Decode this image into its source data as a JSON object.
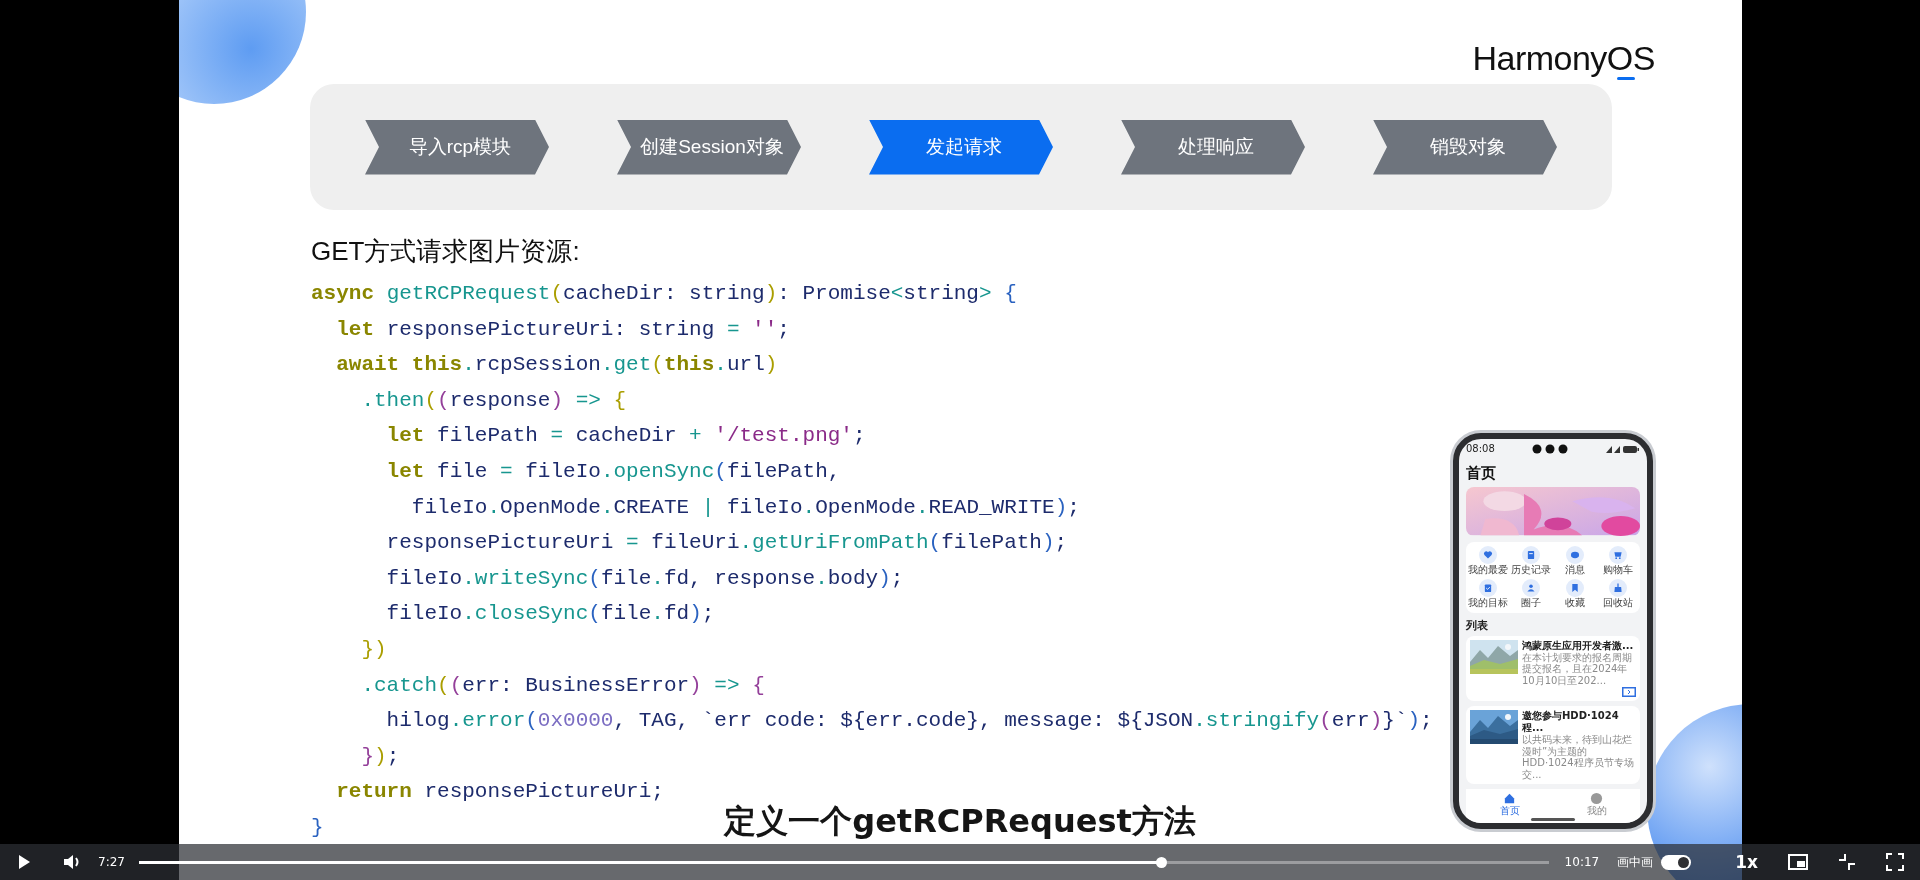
{
  "slide": {
    "logo": "HarmonyOS",
    "steps": [
      {
        "label": "导入rcp模块",
        "selected": false
      },
      {
        "label": "创建Session对象",
        "selected": false
      },
      {
        "label": "发起请求",
        "selected": true
      },
      {
        "label": "处理响应",
        "selected": false
      },
      {
        "label": "销毁对象",
        "selected": false
      }
    ],
    "heading": "GET方式请求图片资源:",
    "code_lines": [
      [
        {
          "kind": "keyword",
          "text": "async "
        },
        {
          "kind": "function",
          "text": "getRCPRequest"
        },
        {
          "kind": "bracket1",
          "text": "("
        },
        {
          "kind": "plain",
          "text": "cacheDir: string"
        },
        {
          "kind": "bracket1",
          "text": ")"
        },
        {
          "kind": "plain",
          "text": ": Promise"
        },
        {
          "kind": "operator",
          "text": "<"
        },
        {
          "kind": "plain",
          "text": "string"
        },
        {
          "kind": "operator",
          "text": "> "
        },
        {
          "kind": "bracket3",
          "text": "{"
        }
      ],
      [
        {
          "kind": "keyword",
          "text": "  let "
        },
        {
          "kind": "plain",
          "text": "responsePictureUri: string "
        },
        {
          "kind": "operator",
          "text": "= "
        },
        {
          "kind": "string",
          "text": "''"
        },
        {
          "kind": "plain",
          "text": ";"
        }
      ],
      [
        {
          "kind": "keyword",
          "text": "  await this"
        },
        {
          "kind": "operator",
          "text": "."
        },
        {
          "kind": "plain",
          "text": "rcpSession"
        },
        {
          "kind": "operator",
          "text": "."
        },
        {
          "kind": "function",
          "text": "get"
        },
        {
          "kind": "bracket1",
          "text": "("
        },
        {
          "kind": "keyword",
          "text": "this"
        },
        {
          "kind": "operator",
          "text": "."
        },
        {
          "kind": "plain",
          "text": "url"
        },
        {
          "kind": "bracket1",
          "text": ")"
        }
      ],
      [
        {
          "kind": "operator",
          "text": "    ."
        },
        {
          "kind": "function",
          "text": "then"
        },
        {
          "kind": "bracket1",
          "text": "("
        },
        {
          "kind": "bracket2",
          "text": "("
        },
        {
          "kind": "plain",
          "text": "response"
        },
        {
          "kind": "bracket2",
          "text": ") "
        },
        {
          "kind": "operator",
          "text": "=> "
        },
        {
          "kind": "bracket1",
          "text": "{"
        }
      ],
      [
        {
          "kind": "keyword",
          "text": "      let "
        },
        {
          "kind": "plain",
          "text": "filePath "
        },
        {
          "kind": "operator",
          "text": "= "
        },
        {
          "kind": "plain",
          "text": "cacheDir "
        },
        {
          "kind": "operator",
          "text": "+ "
        },
        {
          "kind": "string",
          "text": "'/test.png'"
        },
        {
          "kind": "plain",
          "text": ";"
        }
      ],
      [
        {
          "kind": "keyword",
          "text": "      let "
        },
        {
          "kind": "plain",
          "text": "file "
        },
        {
          "kind": "operator",
          "text": "= "
        },
        {
          "kind": "plain",
          "text": "fileIo"
        },
        {
          "kind": "operator",
          "text": "."
        },
        {
          "kind": "function",
          "text": "openSync"
        },
        {
          "kind": "bracket3",
          "text": "("
        },
        {
          "kind": "plain",
          "text": "filePath,"
        }
      ],
      [
        {
          "kind": "plain",
          "text": "        fileIo"
        },
        {
          "kind": "operator",
          "text": "."
        },
        {
          "kind": "plain",
          "text": "OpenMode"
        },
        {
          "kind": "operator",
          "text": "."
        },
        {
          "kind": "plain",
          "text": "CREATE "
        },
        {
          "kind": "operator",
          "text": "| "
        },
        {
          "kind": "plain",
          "text": "fileIo"
        },
        {
          "kind": "operator",
          "text": "."
        },
        {
          "kind": "plain",
          "text": "OpenMode"
        },
        {
          "kind": "operator",
          "text": "."
        },
        {
          "kind": "plain",
          "text": "READ_WRITE"
        },
        {
          "kind": "bracket3",
          "text": ")"
        },
        {
          "kind": "plain",
          "text": ";"
        }
      ],
      [
        {
          "kind": "plain",
          "text": "      responsePictureUri "
        },
        {
          "kind": "operator",
          "text": "= "
        },
        {
          "kind": "plain",
          "text": "fileUri"
        },
        {
          "kind": "operator",
          "text": "."
        },
        {
          "kind": "function",
          "text": "getUriFromPath"
        },
        {
          "kind": "bracket3",
          "text": "("
        },
        {
          "kind": "plain",
          "text": "filePath"
        },
        {
          "kind": "bracket3",
          "text": ")"
        },
        {
          "kind": "plain",
          "text": ";"
        }
      ],
      [
        {
          "kind": "plain",
          "text": "      fileIo"
        },
        {
          "kind": "operator",
          "text": "."
        },
        {
          "kind": "function",
          "text": "writeSync"
        },
        {
          "kind": "bracket3",
          "text": "("
        },
        {
          "kind": "plain",
          "text": "file"
        },
        {
          "kind": "operator",
          "text": "."
        },
        {
          "kind": "plain",
          "text": "fd, response"
        },
        {
          "kind": "operator",
          "text": "."
        },
        {
          "kind": "plain",
          "text": "body"
        },
        {
          "kind": "bracket3",
          "text": ")"
        },
        {
          "kind": "plain",
          "text": ";"
        }
      ],
      [
        {
          "kind": "plain",
          "text": "      fileIo"
        },
        {
          "kind": "operator",
          "text": "."
        },
        {
          "kind": "function",
          "text": "closeSync"
        },
        {
          "kind": "bracket3",
          "text": "("
        },
        {
          "kind": "plain",
          "text": "file"
        },
        {
          "kind": "operator",
          "text": "."
        },
        {
          "kind": "plain",
          "text": "fd"
        },
        {
          "kind": "bracket3",
          "text": ")"
        },
        {
          "kind": "plain",
          "text": ";"
        }
      ],
      [
        {
          "kind": "bracket1",
          "text": "    }"
        },
        {
          "kind": "bracket1",
          "text": ")"
        }
      ],
      [
        {
          "kind": "operator",
          "text": "    ."
        },
        {
          "kind": "function",
          "text": "catch"
        },
        {
          "kind": "bracket1",
          "text": "("
        },
        {
          "kind": "bracket2",
          "text": "("
        },
        {
          "kind": "plain",
          "text": "err: BusinessError"
        },
        {
          "kind": "bracket2",
          "text": ") "
        },
        {
          "kind": "operator",
          "text": "=> "
        },
        {
          "kind": "bracket2",
          "text": "{"
        }
      ],
      [
        {
          "kind": "plain",
          "text": "      hilog"
        },
        {
          "kind": "operator",
          "text": "."
        },
        {
          "kind": "function",
          "text": "error"
        },
        {
          "kind": "bracket3",
          "text": "("
        },
        {
          "kind": "number",
          "text": "0x0000"
        },
        {
          "kind": "plain",
          "text": ", TAG, `err code: ${err.code}, message: ${JSON"
        },
        {
          "kind": "operator",
          "text": "."
        },
        {
          "kind": "function",
          "text": "stringify"
        },
        {
          "kind": "bracket2",
          "text": "("
        },
        {
          "kind": "plain",
          "text": "err"
        },
        {
          "kind": "bracket2",
          "text": ")"
        },
        {
          "kind": "plain",
          "text": "}`"
        },
        {
          "kind": "bracket3",
          "text": ")"
        },
        {
          "kind": "plain",
          "text": ";"
        }
      ],
      [
        {
          "kind": "bracket2",
          "text": "    }"
        },
        {
          "kind": "bracket1",
          "text": ")"
        },
        {
          "kind": "plain",
          "text": ";"
        }
      ],
      [
        {
          "kind": "keyword",
          "text": "  return "
        },
        {
          "kind": "plain",
          "text": "responsePictureUri;"
        }
      ],
      [
        {
          "kind": "bracket3",
          "text": "}"
        }
      ]
    ],
    "phone": {
      "time": "08:08",
      "title": "首页",
      "shortcuts": [
        "我的最爱",
        "历史记录",
        "消息",
        "购物车",
        "我的目标",
        "圈子",
        "收藏",
        "回收站"
      ],
      "list_title": "列表",
      "cards": [
        {
          "title": "鸿蒙原生应用开发者激...",
          "description": "在本计划要求的报名周期提交报名，且在2024年10月10日至202...",
          "more_button": true
        },
        {
          "title": "邀您参与HDD·1024程...",
          "description": "以共码未来，待到山花烂漫时”为主题的HDD·1024程序员节专场交...",
          "more_button": false
        }
      ],
      "tabs": [
        {
          "label": "首页",
          "selected": true
        },
        {
          "label": "我的",
          "selected": false
        }
      ]
    }
  },
  "subtitle": "定义一个getRCPRequest方法",
  "player": {
    "elapsed": "7:27",
    "level": 0.725,
    "duration": "10:17",
    "pip_label": "画中画",
    "pip_on": true,
    "speed": "1x"
  }
}
